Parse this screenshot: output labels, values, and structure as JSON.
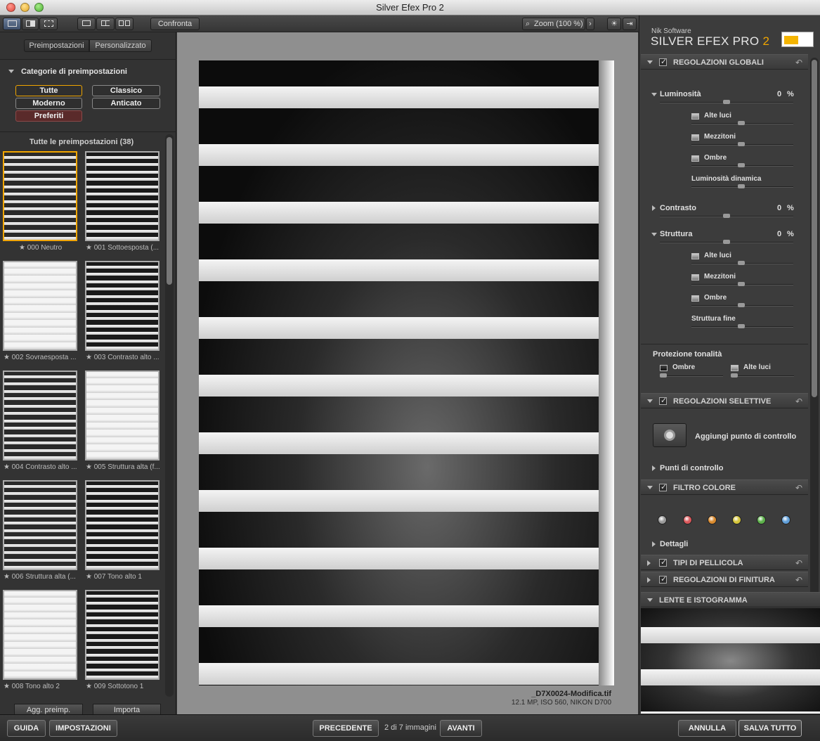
{
  "window": {
    "title": "Silver Efex Pro 2"
  },
  "toolbar": {
    "compare_label": "Confronta",
    "zoom_label": "Zoom (100 %)"
  },
  "left_panel": {
    "tabs": [
      "Preimpostazioni",
      "Personalizzato"
    ],
    "categories_title": "Categorie di preimpostazioni",
    "categories": [
      "Tutte",
      "Classico",
      "Moderno",
      "Anticato",
      "Preferiti"
    ],
    "list_title": "Tutte le preimpostazioni (38)",
    "presets": [
      "000 Neutro",
      "001 Sottoesposta (...",
      "002 Sovraesposta ...",
      "003 Contrasto alto ...",
      "004 Contrasto alto ...",
      "005 Struttura alta (f...",
      "006 Struttura alta (...",
      "007 Tono alto 1",
      "008 Tono alto 2",
      "009 Sottotono 1"
    ],
    "add_preset_label": "Agg. preimp.",
    "import_label": "Importa"
  },
  "image": {
    "file_name": "_D7X0024-Modifica.tif",
    "file_info": "12.1 MP, ISO 560, NIKON D700"
  },
  "right_panel": {
    "brand_small": "Nik Software",
    "brand_main": "SILVER EFEX PRO",
    "brand_version": "2",
    "global_section": "REGOLAZIONI GLOBALI",
    "brightness": {
      "label": "Luminosità",
      "value": "0",
      "unit": "%"
    },
    "brightness_sub": [
      "Alte luci",
      "Mezzitoni",
      "Ombre",
      "Luminosità dinamica"
    ],
    "contrast": {
      "label": "Contrasto",
      "value": "0",
      "unit": "%"
    },
    "structure": {
      "label": "Struttura",
      "value": "0",
      "unit": "%"
    },
    "structure_sub": [
      "Alte luci",
      "Mezzitoni",
      "Ombre",
      "Struttura fine"
    ],
    "tone_protection": {
      "label": "Protezione tonalità",
      "shadows": "Ombre",
      "highlights": "Alte luci"
    },
    "selective_section": "REGOLAZIONI SELETTIVE",
    "add_control_point": "Aggiungi punto di controllo",
    "control_points": "Punti di controllo",
    "color_filter_section": "FILTRO COLORE",
    "filter_colors": [
      "#9a9a9a",
      "#d9575a",
      "#d98a2e",
      "#d4c43a",
      "#5cb04a",
      "#5f9ed8"
    ],
    "details": "Dettagli",
    "film_section": "TIPI DI PELLICOLA",
    "finishing_section": "REGOLAZIONI DI FINITURA",
    "loupe_section": "LENTE E ISTOGRAMMA"
  },
  "bottom_bar": {
    "help_label": "GUIDA",
    "settings_label": "IMPOSTAZIONI",
    "prev_label": "PRECEDENTE",
    "counter": "2 di 7 immagini",
    "next_label": "AVANTI",
    "cancel_label": "ANNULLA",
    "save_label": "SALVA TUTTO"
  },
  "colors": {
    "accent": "#f0a500",
    "panel": "#3a3a3a",
    "canvas": "#8f8f8f"
  }
}
